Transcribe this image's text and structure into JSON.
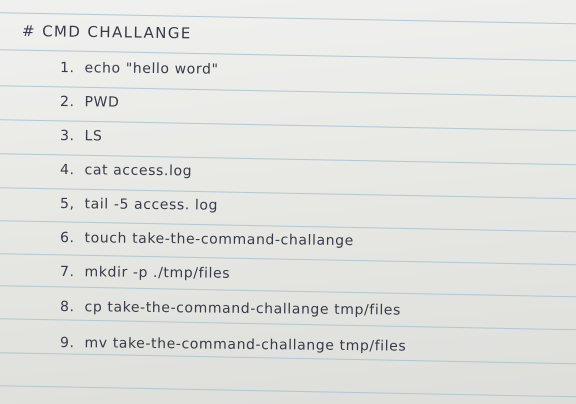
{
  "note": {
    "title": "# CMD CHALLANGE",
    "items": [
      {
        "number": "1.",
        "text": "echo \"hello word\""
      },
      {
        "number": "2.",
        "text": "PWD"
      },
      {
        "number": "3.",
        "text": "LS"
      },
      {
        "number": "4.",
        "text": "cat access.log"
      },
      {
        "number": "5,",
        "text": "tail -5 access. log"
      },
      {
        "number": "6.",
        "text": "touch take-the-command-challange"
      },
      {
        "number": "7.",
        "text": "mkdir -p ./tmp/files"
      },
      {
        "number": "8.",
        "text": "cp take-the-command-challange tmp/files"
      },
      {
        "number": "9.",
        "text": "mv take-the-command-challange tmp/files"
      }
    ]
  },
  "colors": {
    "paper": "#e9e9e6",
    "rule_line": "#a7c7d4",
    "ink": "#383b48"
  }
}
